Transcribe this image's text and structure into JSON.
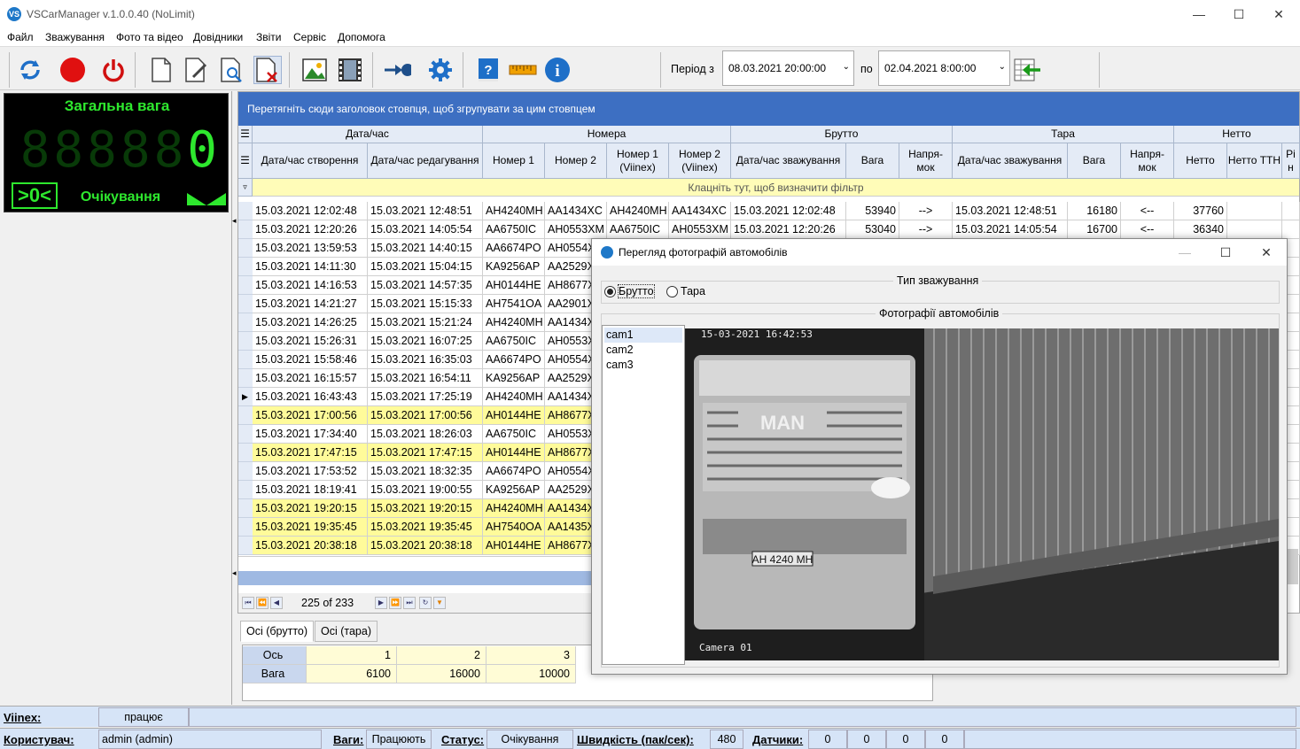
{
  "window": {
    "title": "VSCarManager v.1.0.0.40 (NoLimit)",
    "app_icon": "vs-app-icon"
  },
  "menu": [
    "Файл",
    "Зважування",
    "Фото та відео",
    "Довідники",
    "Звіти",
    "Сервіс",
    "Допомога"
  ],
  "toolbar": {
    "period_from_label": "Період з",
    "period_from": "08.03.2021 20:00:00",
    "period_to_label": "по",
    "period_to": "02.04.2021 8:00:00"
  },
  "scale": {
    "title": "Загальна вага",
    "digits_dim": "88888",
    "value": "0",
    "zero_indicator": ">0<",
    "status": "Очікування"
  },
  "grid": {
    "group_hint": "Перетягніть сюди заголовок стовпця, щоб згрупувати за цим стовпцем",
    "bands": [
      "Дата/час",
      "Номера",
      "Брутто",
      "Тара",
      "Нетто"
    ],
    "columns": [
      "Дата/час створення",
      "Дата/час редагування",
      "Номер 1",
      "Номер 2",
      "Номер 1 (Viinex)",
      "Номер 2 (Viinex)",
      "Дата/час зважування",
      "Вага",
      "Напря-мок",
      "Дата/час зважування",
      "Вага",
      "Напря-мок",
      "Нетто",
      "Нетто ТТН",
      "Рі н"
    ],
    "filter_hint": "Клацніть тут, щоб визначити фільтр",
    "rows": [
      {
        "created": "15.03.2021 12:02:48",
        "edited": "15.03.2021 12:48:51",
        "n1": "AH4240MH",
        "n2": "AA1434XC",
        "v1": "AH4240MH",
        "v2": "AA1434XC",
        "bdt": "15.03.2021 12:02:48",
        "bw": "53940",
        "bdir": "-->",
        "tdt": "15.03.2021 12:48:51",
        "tw": "16180",
        "tdir": "<--",
        "net": "37760",
        "hl": false
      },
      {
        "created": "15.03.2021 12:20:26",
        "edited": "15.03.2021 14:05:54",
        "n1": "AA6750IC",
        "n2": "AH0553XM",
        "v1": "AA6750IC",
        "v2": "AH0553XM",
        "bdt": "15.03.2021 12:20:26",
        "bw": "53040",
        "bdir": "-->",
        "tdt": "15.03.2021 14:05:54",
        "tw": "16700",
        "tdir": "<--",
        "net": "36340",
        "hl": false
      },
      {
        "created": "15.03.2021 13:59:53",
        "edited": "15.03.2021 14:40:15",
        "n1": "AA6674PO",
        "n2": "AH0554X",
        "hl": false
      },
      {
        "created": "15.03.2021 14:11:30",
        "edited": "15.03.2021 15:04:15",
        "n1": "KA9256AP",
        "n2": "AA2529X",
        "hl": false
      },
      {
        "created": "15.03.2021 14:16:53",
        "edited": "15.03.2021 14:57:35",
        "n1": "AH0144HE",
        "n2": "AH8677X",
        "hl": false
      },
      {
        "created": "15.03.2021 14:21:27",
        "edited": "15.03.2021 15:15:33",
        "n1": "AH7541OA",
        "n2": "AA2901X",
        "hl": false
      },
      {
        "created": "15.03.2021 14:26:25",
        "edited": "15.03.2021 15:21:24",
        "n1": "AH4240MH",
        "n2": "AA1434X",
        "hl": false
      },
      {
        "created": "15.03.2021 15:26:31",
        "edited": "15.03.2021 16:07:25",
        "n1": "AA6750IC",
        "n2": "AH0553X",
        "hl": false
      },
      {
        "created": "15.03.2021 15:58:46",
        "edited": "15.03.2021 16:35:03",
        "n1": "AA6674PO",
        "n2": "AH0554X",
        "hl": false
      },
      {
        "created": "15.03.2021 16:15:57",
        "edited": "15.03.2021 16:54:11",
        "n1": "KA9256AP",
        "n2": "AA2529X",
        "hl": false
      },
      {
        "created": "15.03.2021 16:43:43",
        "edited": "15.03.2021 17:25:19",
        "n1": "AH4240MH",
        "n2": "AA1434X",
        "hl": false,
        "current": true
      },
      {
        "created": "15.03.2021 17:00:56",
        "edited": "15.03.2021 17:00:56",
        "n1": "AH0144HE",
        "n2": "AH8677X",
        "hl": true
      },
      {
        "created": "15.03.2021 17:34:40",
        "edited": "15.03.2021 18:26:03",
        "n1": "AA6750IC",
        "n2": "AH0553X",
        "hl": false
      },
      {
        "created": "15.03.2021 17:47:15",
        "edited": "15.03.2021 17:47:15",
        "n1": "AH0144HE",
        "n2": "AH8677X",
        "hl": true
      },
      {
        "created": "15.03.2021 17:53:52",
        "edited": "15.03.2021 18:32:35",
        "n1": "AA6674PO",
        "n2": "AH0554X",
        "hl": false
      },
      {
        "created": "15.03.2021 18:19:41",
        "edited": "15.03.2021 19:00:55",
        "n1": "KA9256AP",
        "n2": "AA2529X",
        "hl": false
      },
      {
        "created": "15.03.2021 19:20:15",
        "edited": "15.03.2021 19:20:15",
        "n1": "AH4240MH",
        "n2": "AA1434X",
        "hl": true
      },
      {
        "created": "15.03.2021 19:35:45",
        "edited": "15.03.2021 19:35:45",
        "n1": "AH7540OA",
        "n2": "AA1435X",
        "hl": true
      },
      {
        "created": "15.03.2021 20:38:18",
        "edited": "15.03.2021 20:38:18",
        "n1": "AH0144HE",
        "n2": "AH8677X",
        "hl": true
      }
    ],
    "pager": "225 of 233"
  },
  "axles": {
    "tabs": [
      "Осі (брутто)",
      "Осі (тара)"
    ],
    "header_label": "Ось",
    "value_label": "Вага",
    "numbers": [
      "1",
      "2",
      "3"
    ],
    "weights": [
      "6100",
      "16000",
      "10000"
    ]
  },
  "dialog": {
    "title": "Перегляд фотографій автомобілів",
    "weigh_type_label": "Тип зважування",
    "option_gross": "Брутто",
    "option_tare": "Тара",
    "photos_label": "Фотографії автомобілів",
    "cameras": [
      "cam1",
      "cam2",
      "cam3"
    ],
    "photo": {
      "timestamp": "15-03-2021 16:42:53",
      "camera_caption": "Camera 01",
      "truck_brand": "MAN",
      "plate": "AH 4240 MH"
    }
  },
  "status": {
    "viinex_label": "Viinex:",
    "viinex_value": "працює",
    "user_label": "Користувач:",
    "user_value": "admin (admin)",
    "scales_label": "Ваги:",
    "scales_value": "Працюють",
    "status_label": "Статус:",
    "status_value": "Очікування",
    "speed_label": "Швидкість (пак/сек):",
    "speed_value": "480",
    "sensors_label": "Датчики:",
    "sensors": [
      "0",
      "0",
      "0",
      "0"
    ]
  }
}
